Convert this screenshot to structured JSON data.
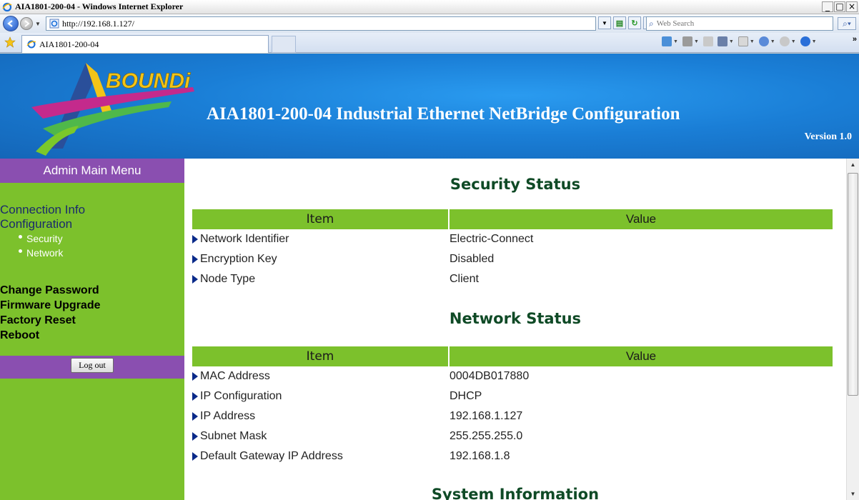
{
  "window": {
    "title": "AIA1801-200-04 - Windows Internet Explorer",
    "min": "_",
    "max": "□",
    "close": "×"
  },
  "address": {
    "url": "http://192.168.1.127/",
    "search_placeholder": "Web Search"
  },
  "tab": {
    "label": "AIA1801-200-04"
  },
  "banner": {
    "logo_text": "BOUNDi",
    "heading": "AIA1801-200-04 Industrial Ethernet NetBridge Configuration",
    "version": "Version 1.0"
  },
  "sidebar": {
    "header": "Admin Main Menu",
    "connection_info": "Connection Info",
    "configuration": "Configuration",
    "sub_items": [
      "Security",
      "Network"
    ],
    "actions": [
      "Change Password",
      "Firmware Upgrade",
      "Factory Reset",
      "Reboot"
    ],
    "logout": "Log out"
  },
  "security_status": {
    "title": "Security Status",
    "headers": [
      "Item",
      "Value"
    ],
    "rows": [
      [
        "Network Identifier",
        "Electric-Connect"
      ],
      [
        "Encryption Key",
        "Disabled"
      ],
      [
        "Node Type",
        "Client"
      ]
    ]
  },
  "network_status": {
    "title": "Network Status",
    "headers": [
      "Item",
      "Value"
    ],
    "rows": [
      [
        "MAC Address",
        "0004DB017880"
      ],
      [
        "IP Configuration",
        "DHCP"
      ],
      [
        "IP Address",
        "192.168.1.127"
      ],
      [
        "Subnet Mask",
        "255.255.255.0"
      ],
      [
        "Default Gateway IP Address",
        "192.168.1.8"
      ]
    ]
  },
  "system_info": {
    "title": "System Information"
  },
  "colors": {
    "sidebar_green": "#7cc12c",
    "purple": "#8a4fb0",
    "banner_blue": "#1a7ed6",
    "section_title": "#0f4a26"
  }
}
